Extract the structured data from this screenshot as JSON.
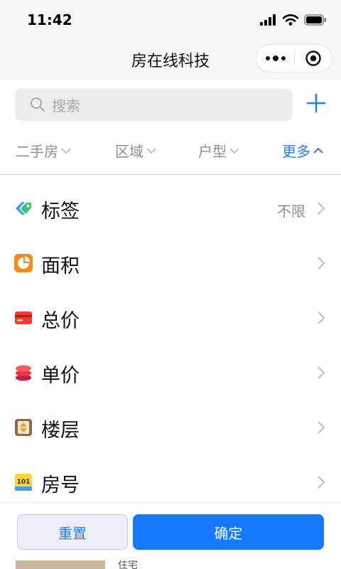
{
  "status_bar": {
    "time": "11:42"
  },
  "nav": {
    "title": "房在线科技"
  },
  "search": {
    "placeholder": "搜索"
  },
  "filters": [
    {
      "label": "二手房",
      "active": false
    },
    {
      "label": "区域",
      "active": false
    },
    {
      "label": "户型",
      "active": false
    },
    {
      "label": "更多",
      "active": true
    }
  ],
  "options": [
    {
      "label": "标签",
      "value": "不限",
      "icon": "tag-icon"
    },
    {
      "label": "面积",
      "value": "",
      "icon": "area-icon"
    },
    {
      "label": "总价",
      "value": "",
      "icon": "total-price-icon"
    },
    {
      "label": "单价",
      "value": "",
      "icon": "unit-price-icon"
    },
    {
      "label": "楼层",
      "value": "",
      "icon": "floor-icon"
    },
    {
      "label": "房号",
      "value": "",
      "icon": "room-number-icon",
      "icon_text": "101"
    }
  ],
  "buttons": {
    "reset": "重置",
    "confirm": "确定"
  },
  "peek": {
    "text": "住宅"
  },
  "colors": {
    "accent": "#2d7de9",
    "primary_button": "#1677ff",
    "filter_text": "#8e8e8e"
  }
}
